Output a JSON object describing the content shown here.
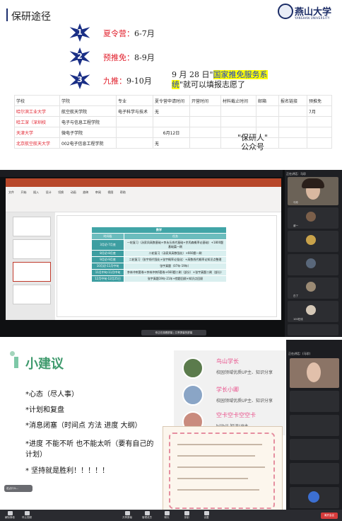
{
  "slide": {
    "title": "保研途径",
    "logo_cn": "燕山大学",
    "logo_en": "YANSHAN UNIVERSITY",
    "steps": [
      {
        "num": "1",
        "label": "夏令营：",
        "time": "6-7月"
      },
      {
        "num": "2",
        "label": "预推免：",
        "time": "8-9月"
      },
      {
        "num": "3",
        "label": "九推：",
        "time": "9-10月"
      }
    ],
    "note_prefix": "9 月 28 日\"",
    "note_hl": "国家推免服务系统",
    "note_suffix": "\"就可以填报志愿了",
    "table_headers": [
      "学校",
      "学院",
      "专业",
      "夏令营申请时间",
      "开营时间",
      "材料截止时间",
      "邮箱",
      "报名链接",
      "预推免"
    ],
    "table_rows": [
      [
        "哈尔滨工业大学",
        "航空航天学院",
        "电子科学与技术",
        "无",
        "",
        "",
        "",
        "",
        "7月"
      ],
      [
        "哈工深（深圳校",
        "电子与信息工程学院",
        "",
        "",
        "",
        "",
        "",
        "",
        ""
      ],
      [
        "天津大学",
        "微电子学院",
        "",
        "6月12日",
        "",
        "",
        "",
        "",
        ""
      ],
      [
        "北京航空航天大学",
        "002电子信息工程学院",
        "",
        "无",
        "",
        "",
        "",
        "",
        ""
      ]
    ],
    "watermark_line1": "\"保研人\"",
    "watermark_line2": "公众号"
  },
  "meeting1": {
    "ppt_tabs": [
      "文件",
      "开始",
      "插入",
      "设计",
      "切换",
      "动画",
      "放映",
      "审阅",
      "视图",
      "帮助"
    ],
    "table_title": "数学",
    "table_sub": [
      "时间段",
      "任务"
    ],
    "table_rows": [
      [
        "3月初-7月底",
        "一轮复习（汤家凤高数基础+李永乐线代基础+余丙森概率论基础）+1800题基础篇一刷"
      ],
      [
        "8月初-8月底",
        "二轮复习（汤家凤高数强化）+660题一刷"
      ],
      [
        "9月初-9月底",
        "二轮复习（张宇线代强化+张宇概率论强化）+高数线代概率论知识点整理"
      ],
      [
        "10月初-11月中旬",
        "张宇真题（07年-19年）"
      ],
      [
        "11月中旬-11月中旬",
        "李林冲刺套卷+李林冲刺6套卷+660题二刷（部分）+张宇真题二刷（部分）"
      ],
      [
        "12月中旬-12月25日",
        "张宇真题19年-21年+错题回顾+知识点回顾"
      ]
    ],
    "share_bar": "你正在观看屏幕 | 共享屏幕的屏幕",
    "panel_title": "正在讲话：马珍",
    "participants": [
      "马珍",
      "谢一",
      "",
      "",
      "",
      "",
      "白了",
      "100在线",
      "",
      ""
    ]
  },
  "suggestions": {
    "title": "小建议",
    "items": [
      "*心态（尽人事）",
      "*计划和复盘",
      "*消息闭塞（时间点 方法 进度 大纲）",
      "*进度 不能不听 也不能太听（要有自己的计划）",
      "* 坚持就是胜利！！！！！"
    ],
    "people": [
      {
        "name": "鸟山学长",
        "desc": "校园领域优质UP主、知识分享"
      },
      {
        "name": "学长小卿",
        "desc": "校园领域优质UP主、知识分享"
      },
      {
        "name": "空卡空卡空空卡",
        "desc": "bilibili 知识UP主"
      }
    ],
    "chat_label": "说点什么...",
    "panel_title": "正在讲话：(马珍)",
    "toolbar": [
      "解除静音",
      "停止视频",
      "",
      "",
      "",
      "",
      "共享屏幕",
      "管理成员",
      "聊天",
      "录制",
      "设置"
    ],
    "end_label": "离开会议"
  },
  "colors": {
    "navy": "#1a2f86",
    "red": "#e11d2a",
    "teal": "#41a5a7",
    "green": "#3f9a6d",
    "pink": "#e94f8a"
  }
}
